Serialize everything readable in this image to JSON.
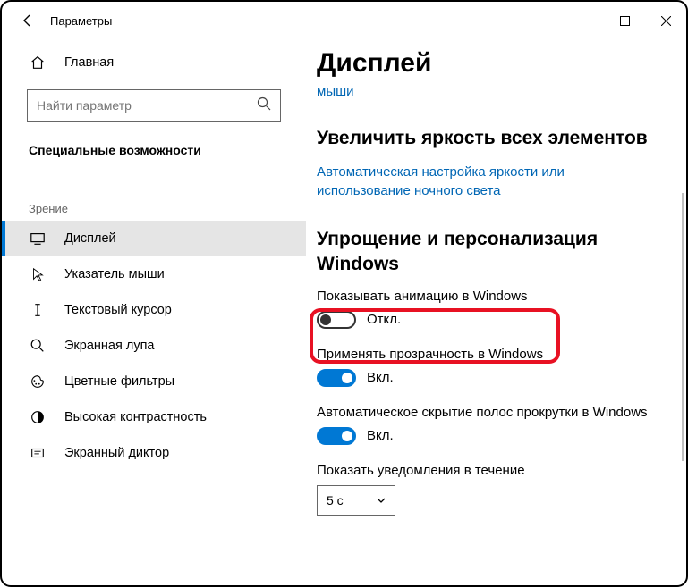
{
  "titlebar": {
    "title": "Параметры"
  },
  "sidebar": {
    "home": "Главная",
    "search_placeholder": "Найти параметр",
    "section": "Специальные возможности",
    "group": "Зрение",
    "items": [
      {
        "label": "Дисплей"
      },
      {
        "label": "Указатель мыши"
      },
      {
        "label": "Текстовый курсор"
      },
      {
        "label": "Экранная лупа"
      },
      {
        "label": "Цветные фильтры"
      },
      {
        "label": "Высокая контрастность"
      },
      {
        "label": "Экранный диктор"
      }
    ]
  },
  "main": {
    "heading": "Дисплей",
    "partial_link": "мыши",
    "h2a": "Увеличить яркость всех элементов",
    "link_a": "Автоматическая настройка яркости или использование ночного света",
    "h2b": "Упрощение и персонализация Windows",
    "settings": [
      {
        "label": "Показывать анимацию в Windows",
        "state": "Откл."
      },
      {
        "label": "Применять прозрачность в Windows",
        "state": "Вкл."
      },
      {
        "label": "Автоматическое скрытие полос прокрутки в Windows",
        "state": "Вкл."
      },
      {
        "label": "Показать уведомления в течение"
      }
    ],
    "select_value": "5 с"
  }
}
